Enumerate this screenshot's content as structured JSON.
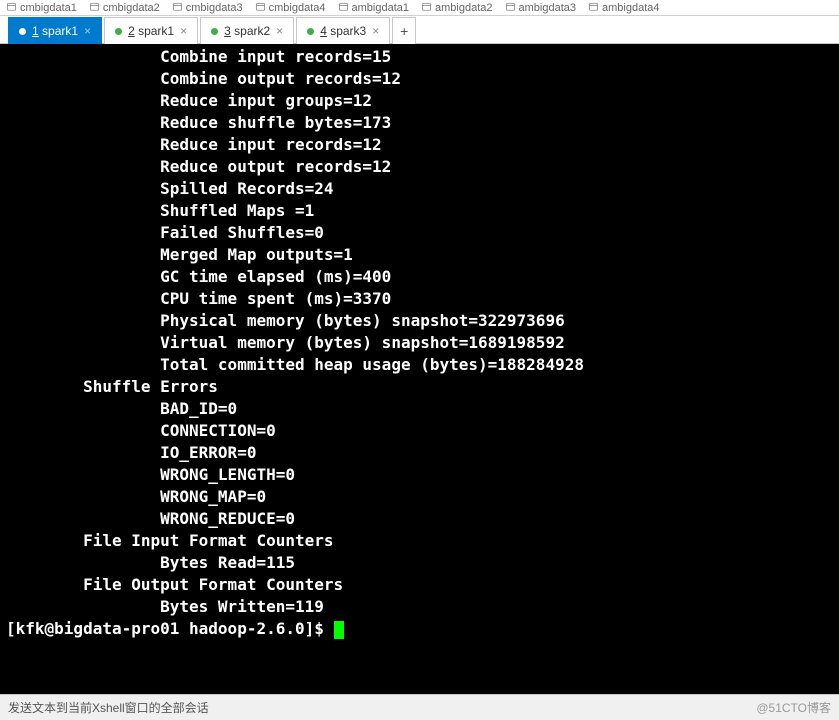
{
  "bookmarks": [
    "cmbigdata1",
    "cmbigdata2",
    "cmbigdata3",
    "cmbigdata4",
    "ambigdata1",
    "ambigdata2",
    "ambigdata3",
    "ambigdata4"
  ],
  "tabs": [
    {
      "num": "1",
      "name": "spark1",
      "active": true
    },
    {
      "num": "2",
      "name": "spark1",
      "active": false
    },
    {
      "num": "3",
      "name": "spark2",
      "active": false
    },
    {
      "num": "4",
      "name": "spark3",
      "active": false
    }
  ],
  "terminal": {
    "lines": [
      "                Combine input records=15",
      "                Combine output records=12",
      "                Reduce input groups=12",
      "                Reduce shuffle bytes=173",
      "                Reduce input records=12",
      "                Reduce output records=12",
      "                Spilled Records=24",
      "                Shuffled Maps =1",
      "                Failed Shuffles=0",
      "                Merged Map outputs=1",
      "                GC time elapsed (ms)=400",
      "                CPU time spent (ms)=3370",
      "                Physical memory (bytes) snapshot=322973696",
      "                Virtual memory (bytes) snapshot=1689198592",
      "                Total committed heap usage (bytes)=188284928",
      "        Shuffle Errors",
      "                BAD_ID=0",
      "                CONNECTION=0",
      "                IO_ERROR=0",
      "                WRONG_LENGTH=0",
      "                WRONG_MAP=0",
      "                WRONG_REDUCE=0",
      "        File Input Format Counters ",
      "                Bytes Read=115",
      "        File Output Format Counters ",
      "                Bytes Written=119"
    ],
    "prompt": "[kfk@bigdata-pro01 hadoop-2.6.0]$ "
  },
  "footer": {
    "left": "发送文本到当前Xshell窗口的全部会话",
    "right": "@51CTO博客"
  }
}
